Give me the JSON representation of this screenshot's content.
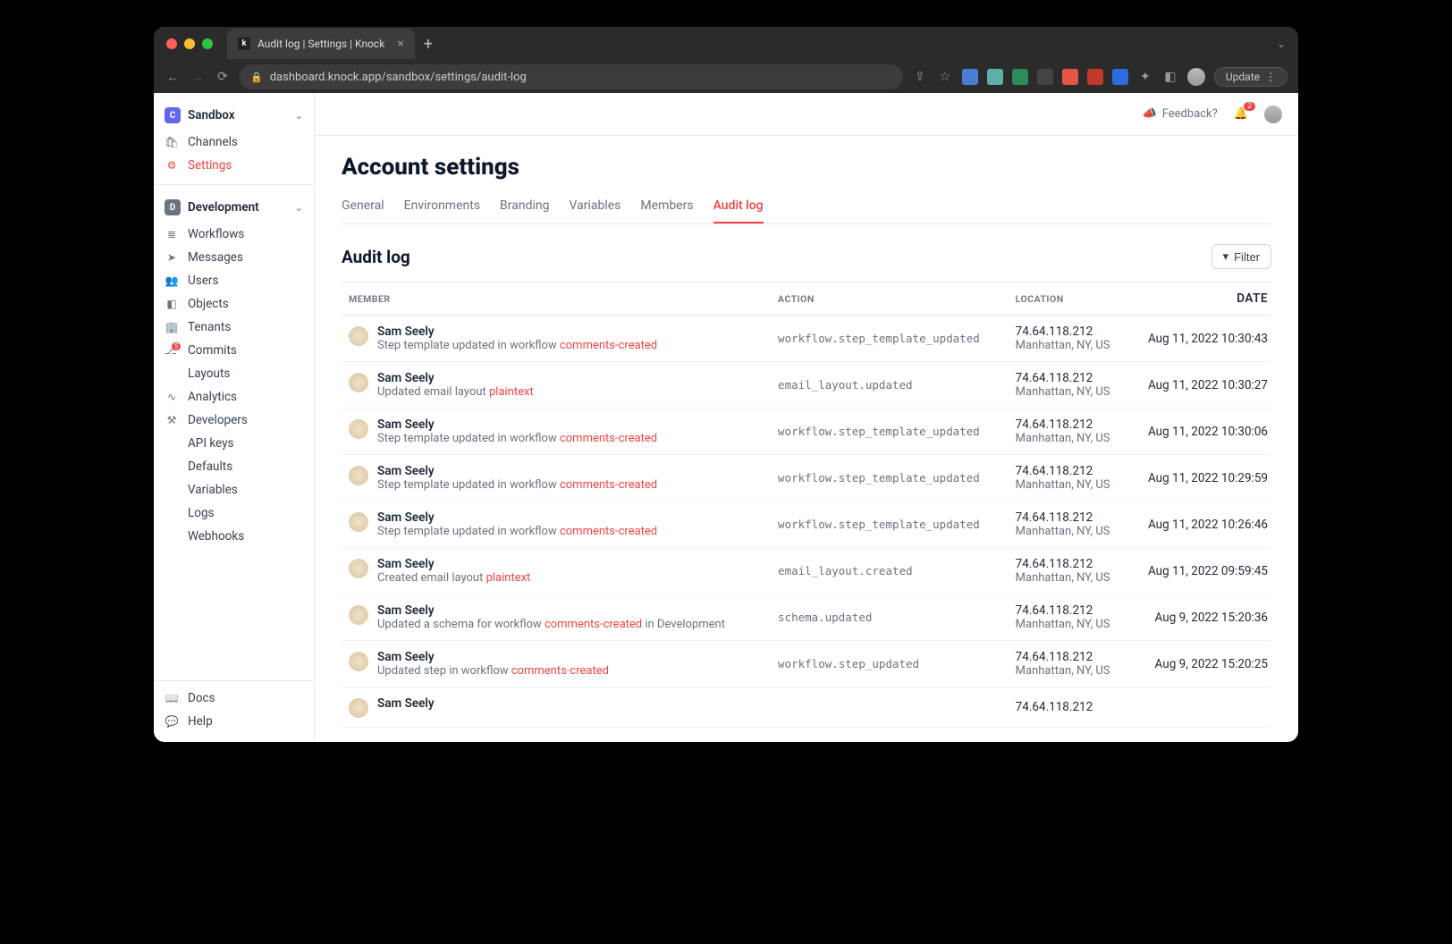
{
  "browser": {
    "tab_title": "Audit log | Settings | Knock",
    "url": "dashboard.knock.app/sandbox/settings/audit-log",
    "update_label": "Update"
  },
  "topbar": {
    "feedback": "Feedback?",
    "notif_count": "2"
  },
  "sidebar": {
    "section1": {
      "title": "Sandbox",
      "items": [
        {
          "icon": "🛍",
          "label": "Channels"
        },
        {
          "icon": "⚙",
          "label": "Settings",
          "active": true
        }
      ]
    },
    "section2": {
      "title": "Development",
      "items": [
        {
          "icon": "≣",
          "label": "Workflows"
        },
        {
          "icon": "➤",
          "label": "Messages"
        },
        {
          "icon": "👥",
          "label": "Users"
        },
        {
          "icon": "◧",
          "label": "Objects"
        },
        {
          "icon": "🏢",
          "label": "Tenants"
        },
        {
          "icon": "⎇",
          "label": "Commits",
          "pill": "5"
        },
        {
          "icon": "</>",
          "label": "Layouts"
        },
        {
          "icon": "∿",
          "label": "Analytics"
        },
        {
          "icon": "⚒",
          "label": "Developers"
        }
      ],
      "sub": [
        "API keys",
        "Defaults",
        "Variables",
        "Logs",
        "Webhooks"
      ]
    },
    "footer": [
      {
        "icon": "📖",
        "label": "Docs"
      },
      {
        "icon": "💬",
        "label": "Help"
      }
    ]
  },
  "page": {
    "title": "Account settings",
    "tabs": [
      "General",
      "Environments",
      "Branding",
      "Variables",
      "Members",
      "Audit log"
    ],
    "active_tab": 5,
    "section_title": "Audit log",
    "filter_label": "Filter",
    "columns": {
      "member": "MEMBER",
      "action": "ACTION",
      "location": "LOCATION",
      "date": "DATE"
    }
  },
  "rows": [
    {
      "name": "Sam Seely",
      "desc_pre": "Step template updated in workflow ",
      "desc_hl": "comments-created",
      "desc_post": "",
      "action": "workflow.step_template_updated",
      "ip": "74.64.118.212",
      "place": "Manhattan, NY, US",
      "date": "Aug 11, 2022 10:30:43"
    },
    {
      "name": "Sam Seely",
      "desc_pre": "Updated email layout ",
      "desc_hl": "plaintext",
      "desc_post": "",
      "action": "email_layout.updated",
      "ip": "74.64.118.212",
      "place": "Manhattan, NY, US",
      "date": "Aug 11, 2022 10:30:27"
    },
    {
      "name": "Sam Seely",
      "desc_pre": "Step template updated in workflow ",
      "desc_hl": "comments-created",
      "desc_post": "",
      "action": "workflow.step_template_updated",
      "ip": "74.64.118.212",
      "place": "Manhattan, NY, US",
      "date": "Aug 11, 2022 10:30:06"
    },
    {
      "name": "Sam Seely",
      "desc_pre": "Step template updated in workflow ",
      "desc_hl": "comments-created",
      "desc_post": "",
      "action": "workflow.step_template_updated",
      "ip": "74.64.118.212",
      "place": "Manhattan, NY, US",
      "date": "Aug 11, 2022 10:29:59"
    },
    {
      "name": "Sam Seely",
      "desc_pre": "Step template updated in workflow ",
      "desc_hl": "comments-created",
      "desc_post": "",
      "action": "workflow.step_template_updated",
      "ip": "74.64.118.212",
      "place": "Manhattan, NY, US",
      "date": "Aug 11, 2022 10:26:46"
    },
    {
      "name": "Sam Seely",
      "desc_pre": "Created email layout ",
      "desc_hl": "plaintext",
      "desc_post": "",
      "action": "email_layout.created",
      "ip": "74.64.118.212",
      "place": "Manhattan, NY, US",
      "date": "Aug 11, 2022 09:59:45"
    },
    {
      "name": "Sam Seely",
      "desc_pre": "Updated a schema for workflow ",
      "desc_hl": "comments-created",
      "desc_post": " in Development",
      "action": "schema.updated",
      "ip": "74.64.118.212",
      "place": "Manhattan, NY, US",
      "date": "Aug 9, 2022 15:20:36"
    },
    {
      "name": "Sam Seely",
      "desc_pre": "Updated step in workflow ",
      "desc_hl": "comments-created",
      "desc_post": "",
      "action": "workflow.step_updated",
      "ip": "74.64.118.212",
      "place": "Manhattan, NY, US",
      "date": "Aug 9, 2022 15:20:25"
    },
    {
      "name": "Sam Seely",
      "desc_pre": "",
      "desc_hl": "",
      "desc_post": "",
      "action": "",
      "ip": "74.64.118.212",
      "place": "",
      "date": ""
    }
  ]
}
